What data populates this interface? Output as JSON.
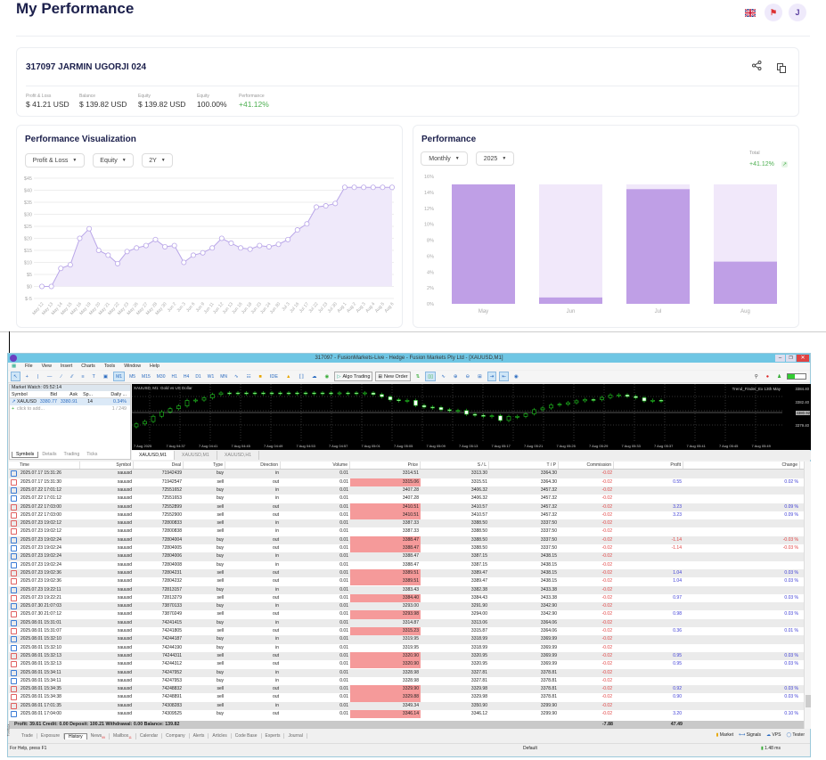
{
  "header": {
    "title": "My Performance",
    "avatar_initial": "J",
    "icons": [
      "uk-flag-icon",
      "notification-icon"
    ]
  },
  "account": {
    "title": "317097 JARMIN UGORJI 024",
    "icons": [
      "share-icon",
      "copy-icon"
    ],
    "stats": [
      {
        "label": "Profit & Loss",
        "value": "$ 41.21 USD"
      },
      {
        "label": "Balance",
        "value": "$ 139.82 USD"
      },
      {
        "label": "Equity",
        "value": "$ 139.82 USD"
      },
      {
        "label": "Equity",
        "value": "100.00%"
      },
      {
        "label": "Performance",
        "value": "+41.12%"
      }
    ],
    "positive_color": "#4caf50"
  },
  "viz": {
    "title": "Performance Visualization",
    "dropdowns": [
      "Profit & Loss",
      "Equity",
      "2Y"
    ]
  },
  "perf": {
    "title": "Performance",
    "dropdowns": [
      "Monthly",
      "2025"
    ],
    "total_label": "Total",
    "total_value": "+41.12%"
  },
  "chart_data": [
    {
      "type": "area",
      "title": "",
      "accent": "#b9a6e8",
      "ylim": [
        -5,
        45
      ],
      "y_ticks": [
        "$-5",
        "$0",
        "$5",
        "$10",
        "$15",
        "$20",
        "$25",
        "$30",
        "$35",
        "$40",
        "$45"
      ],
      "y_tick_values": [
        -5,
        0,
        5,
        10,
        15,
        20,
        25,
        30,
        35,
        40,
        45
      ],
      "grid": true,
      "categories": [
        "May 12",
        "May 13",
        "May 14",
        "May 15",
        "May 16",
        "May 19",
        "May 20",
        "May 21",
        "May 22",
        "May 23",
        "May 26",
        "May 27",
        "May 28",
        "May 30",
        "Jun 2",
        "Jun 3",
        "Jun 6",
        "Jun 9",
        "Jun 11",
        "Jun 12",
        "Jun 13",
        "Jun 16",
        "Jun 18",
        "Jun 23",
        "Jun 24",
        "Jun 30",
        "Jul 3",
        "Jul 16",
        "Jul 17",
        "Jul 22",
        "Jul 23",
        "Jul 30",
        "Aug 1",
        "Aug 2",
        "Aug 3",
        "Aug 4",
        "Aug 5",
        "Aug 6"
      ],
      "values": [
        0,
        0,
        7.5,
        9,
        20,
        24,
        15,
        13,
        9.5,
        14.5,
        16,
        17,
        19.5,
        16.5,
        17,
        10,
        13,
        14,
        16,
        20,
        18,
        16,
        15.5,
        17,
        16.5,
        17.5,
        19.5,
        23.5,
        26,
        33,
        33.5,
        34.5,
        41.2,
        41.2,
        41.2,
        41.2,
        41.2,
        41.2
      ]
    },
    {
      "type": "bar",
      "title": "",
      "accent": "#bf9fe6",
      "background_bar_color": "#f1e8fa",
      "ylim": [
        0,
        16
      ],
      "y_ticks": [
        "0%",
        "2%",
        "4%",
        "6%",
        "8%",
        "10%",
        "12%",
        "14%",
        "16%"
      ],
      "y_tick_values": [
        0,
        2,
        4,
        6,
        8,
        10,
        12,
        14,
        16
      ],
      "categories": [
        "May",
        "Jun",
        "Jul",
        "Aug"
      ],
      "values": [
        15.0,
        0.8,
        14.4,
        5.3
      ]
    }
  ],
  "mt5": {
    "title": "317097 - FusionMarkets-Live - Hedge - Fusion Markets Pty Ltd - [XAUUSD,M1]",
    "menu": [
      "File",
      "View",
      "Insert",
      "Charts",
      "Tools",
      "Window",
      "Help"
    ],
    "timeframes": [
      "M1",
      "M5",
      "M15",
      "M30",
      "H1",
      "H4",
      "D1",
      "W1",
      "MN"
    ],
    "active_timeframe": "M1",
    "algo_trading": "Algo Trading",
    "new_order": "New Order",
    "market_watch": {
      "title": "Market Watch: 05:52:14",
      "columns": [
        "Symbol",
        "Bid",
        "Ask",
        "Sp...",
        "Daily ..."
      ],
      "row": {
        "symbol": "XAUUSD",
        "bid": "3380.77",
        "ask": "3380.91",
        "spread": "14",
        "daily": "0.34%"
      },
      "add": "click to add...",
      "count": "1 / 249",
      "tabs": [
        "Symbols",
        "Details",
        "Trading",
        "Ticks"
      ]
    },
    "chart": {
      "label": "XAUUSD, M1:  Gold vs US Dollar",
      "indicator": "Trend_Finder_Ex 13th May",
      "prices": [
        "3384.40",
        "3382.40",
        "3380.92",
        "3379.40"
      ],
      "times": [
        "7 Aug 2025",
        "7 Aug 04:37",
        "7 Aug 04:41",
        "7 Aug 04:45",
        "7 Aug 04:49",
        "7 Aug 04:53",
        "7 Aug 04:57",
        "7 Aug 05:01",
        "7 Aug 05:05",
        "7 Aug 05:09",
        "7 Aug 05:13",
        "7 Aug 05:17",
        "7 Aug 05:21",
        "7 Aug 05:25",
        "7 Aug 05:29",
        "7 Aug 05:33",
        "7 Aug 05:37",
        "7 Aug 05:41",
        "7 Aug 05:45",
        "7 Aug 05:49"
      ],
      "tabs": [
        "XAUUSD,M1",
        "XAUUSD,M1",
        "XAUUSD,H1"
      ]
    },
    "history": {
      "columns": [
        "Time",
        "Symbol",
        "Deal",
        "Type",
        "Direction",
        "Volume",
        "Price",
        "S / L",
        "T / P",
        "Commission",
        "Profit",
        "Change"
      ],
      "rows": [
        [
          "2025.07.17 15:31:26",
          "xauusd",
          "71942439",
          "buy",
          "in",
          "0.01",
          "3314.51",
          "3313.30",
          "3364.30",
          "-0.02",
          "",
          ""
        ],
        [
          "2025.07.17 15:31:30",
          "xauusd",
          "71942547",
          "sell",
          "out",
          "0.01",
          "3315.06",
          "3315.51",
          "3364.30",
          "-0.02",
          "0.55",
          "0.02 %"
        ],
        [
          "2025.07.22 17:01:12",
          "xauusd",
          "72551652",
          "buy",
          "in",
          "0.01",
          "3407.28",
          "3406.32",
          "3457.32",
          "-0.02",
          "",
          ""
        ],
        [
          "2025.07.22 17:01:12",
          "xauusd",
          "72551653",
          "buy",
          "in",
          "0.01",
          "3407.28",
          "3406.32",
          "3457.32",
          "-0.02",
          "",
          ""
        ],
        [
          "2025.07.22 17:03:00",
          "xauusd",
          "72552899",
          "sell",
          "out",
          "0.01",
          "3410.51",
          "3410.57",
          "3457.32",
          "-0.02",
          "3.23",
          "0.09 %"
        ],
        [
          "2025.07.22 17:03:00",
          "xauusd",
          "72552900",
          "sell",
          "out",
          "0.01",
          "3410.51",
          "3410.57",
          "3457.32",
          "-0.02",
          "3.23",
          "0.09 %"
        ],
        [
          "2025.07.23 19:02:12",
          "xauusd",
          "72800833",
          "sell",
          "in",
          "0.01",
          "3387.33",
          "3388.50",
          "3337.50",
          "-0.02",
          "",
          ""
        ],
        [
          "2025.07.23 19:02:12",
          "xauusd",
          "72800838",
          "sell",
          "in",
          "0.01",
          "3387.33",
          "3388.50",
          "3337.50",
          "-0.02",
          "",
          ""
        ],
        [
          "2025.07.23 19:02:24",
          "xauusd",
          "72804004",
          "buy",
          "out",
          "0.01",
          "3388.47",
          "3388.50",
          "3337.50",
          "-0.02",
          "-1.14",
          "-0.03 %"
        ],
        [
          "2025.07.23 19:02:24",
          "xauusd",
          "72804005",
          "buy",
          "out",
          "0.01",
          "3388.47",
          "3388.50",
          "3337.50",
          "-0.02",
          "-1.14",
          "-0.03 %"
        ],
        [
          "2025.07.23 19:02:24",
          "xauusd",
          "72804006",
          "buy",
          "in",
          "0.01",
          "3388.47",
          "3387.15",
          "3438.15",
          "-0.02",
          "",
          ""
        ],
        [
          "2025.07.23 19:02:24",
          "xauusd",
          "72804008",
          "buy",
          "in",
          "0.01",
          "3388.47",
          "3387.15",
          "3438.15",
          "-0.02",
          "",
          ""
        ],
        [
          "2025.07.23 19:02:36",
          "xauusd",
          "72804231",
          "sell",
          "out",
          "0.01",
          "3389.51",
          "3389.47",
          "3438.15",
          "-0.02",
          "1.04",
          "0.03 %"
        ],
        [
          "2025.07.23 19:02:36",
          "xauusd",
          "72804232",
          "sell",
          "out",
          "0.01",
          "3389.51",
          "3389.47",
          "3438.15",
          "-0.02",
          "1.04",
          "0.03 %"
        ],
        [
          "2025.07.23 19:22:11",
          "xauusd",
          "72813157",
          "buy",
          "in",
          "0.01",
          "3383.43",
          "3382.38",
          "3433.38",
          "-0.02",
          "",
          ""
        ],
        [
          "2025.07.23 19:22:21",
          "xauusd",
          "72813279",
          "sell",
          "out",
          "0.01",
          "3384.40",
          "3384.43",
          "3433.38",
          "-0.02",
          "0.97",
          "0.03 %"
        ],
        [
          "2025.07.30 21:07:03",
          "xauusd",
          "73870133",
          "buy",
          "in",
          "0.01",
          "3293.00",
          "3291.90",
          "3342.90",
          "-0.02",
          "",
          ""
        ],
        [
          "2025.07.30 21:07:12",
          "xauusd",
          "73870249",
          "sell",
          "out",
          "0.01",
          "3293.98",
          "3294.00",
          "3342.90",
          "-0.02",
          "0.98",
          "0.03 %"
        ],
        [
          "2025.08.01 15:31:01",
          "xauusd",
          "74241415",
          "buy",
          "in",
          "0.01",
          "3314.87",
          "3313.06",
          "3364.06",
          "-0.02",
          "",
          ""
        ],
        [
          "2025.08.01 15:31:07",
          "xauusd",
          "74241805",
          "sell",
          "out",
          "0.01",
          "3315.23",
          "3315.87",
          "3364.06",
          "-0.02",
          "0.36",
          "0.01 %"
        ],
        [
          "2025.08.01 15:32:10",
          "xauusd",
          "74244187",
          "buy",
          "in",
          "0.01",
          "3319.95",
          "3318.99",
          "3369.99",
          "-0.02",
          "",
          ""
        ],
        [
          "2025.08.01 15:32:10",
          "xauusd",
          "74244190",
          "buy",
          "in",
          "0.01",
          "3319.95",
          "3318.99",
          "3369.99",
          "-0.02",
          "",
          ""
        ],
        [
          "2025.08.01 15:32:13",
          "xauusd",
          "74244311",
          "sell",
          "out",
          "0.01",
          "3320.90",
          "3320.95",
          "3369.99",
          "-0.02",
          "0.95",
          "0.03 %"
        ],
        [
          "2025.08.01 15:32:13",
          "xauusd",
          "74244312",
          "sell",
          "out",
          "0.01",
          "3320.90",
          "3320.95",
          "3369.99",
          "-0.02",
          "0.95",
          "0.03 %"
        ],
        [
          "2025.08.01 15:34:11",
          "xauusd",
          "74247952",
          "buy",
          "in",
          "0.01",
          "3328.98",
          "3327.81",
          "3378.81",
          "-0.02",
          "",
          ""
        ],
        [
          "2025.08.01 15:34:11",
          "xauusd",
          "74247953",
          "buy",
          "in",
          "0.01",
          "3328.98",
          "3327.81",
          "3378.81",
          "-0.02",
          "",
          ""
        ],
        [
          "2025.08.01 15:34:35",
          "xauusd",
          "74248832",
          "sell",
          "out",
          "0.01",
          "3329.90",
          "3329.98",
          "3378.81",
          "-0.02",
          "0.92",
          "0.03 %"
        ],
        [
          "2025.08.01 15:34:38",
          "xauusd",
          "74248891",
          "sell",
          "out",
          "0.01",
          "3329.88",
          "3329.98",
          "3378.81",
          "-0.02",
          "0.90",
          "0.03 %"
        ],
        [
          "2025.08.01 17:01:35",
          "xauusd",
          "74308283",
          "sell",
          "in",
          "0.01",
          "3349.34",
          "3350.90",
          "3299.90",
          "-0.02",
          "",
          ""
        ],
        [
          "2025.08.01 17:04:00",
          "xauusd",
          "74309525",
          "buy",
          "out",
          "0.01",
          "3346.14",
          "3346.12",
          "3299.90",
          "-0.02",
          "3.20",
          "0.10 %"
        ]
      ],
      "summary": "Profit: 39.61  Credit: 0.00  Deposit: 100.21  Withdrawal: 0.00  Balance: 139.82",
      "total_commission": "-7.88",
      "total_profit": "47.49"
    },
    "bottom_tabs": [
      "Trade",
      "Exposure",
      "History",
      "News",
      "Mailbox",
      "Calendar",
      "Company",
      "Alerts",
      "Articles",
      "Code Base",
      "Experts",
      "Journal"
    ],
    "active_bottom_tab": "History",
    "news_badge": "99",
    "mailbox_badge": "11",
    "right_links": [
      "Market",
      "Signals",
      "VPS",
      "Tester"
    ],
    "toolbox_label": "Toolbox",
    "status": {
      "help": "For Help, press F1",
      "profile": "Default",
      "ping": "1.48 ms"
    }
  }
}
